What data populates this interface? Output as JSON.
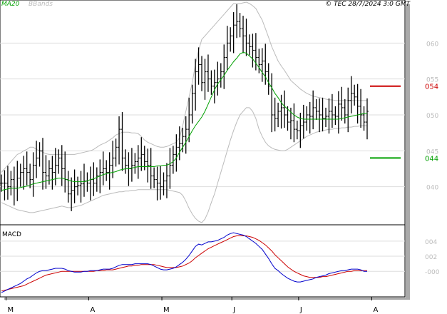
{
  "header": {
    "ma_label": "MA20",
    "bb_label": "BBands",
    "copyright": "© TEC 28/7/2024 3:0 GMT",
    "ma_color": "#00a000",
    "bb_color": "#bbbbbb"
  },
  "macd": {
    "label": "MACD",
    "macd_color": "#0000cc",
    "signal_color": "#cc0000"
  },
  "levels": {
    "resistance": {
      "label": "054",
      "value": 0.54,
      "color": "#cc0000"
    },
    "support": {
      "label": "044",
      "value": 0.44,
      "color": "#00a000"
    }
  },
  "chart_data": [
    {
      "type": "ohlc",
      "x_ticks": [
        "M",
        "A",
        "M",
        "J",
        "J",
        "A"
      ],
      "y_ticks": [
        "040",
        "045",
        "050",
        "055",
        "060"
      ],
      "y_tick_values": [
        0.4,
        0.45,
        0.5,
        0.55,
        0.6
      ],
      "ylim": [
        0.35,
        0.65
      ],
      "series": [
        {
          "kind": "close",
          "values": [
            0.405,
            0.405,
            0.4,
            0.41,
            0.398,
            0.412,
            0.42,
            0.425,
            0.42,
            0.41,
            0.43,
            0.44,
            0.45,
            0.42,
            0.415,
            0.425,
            0.42,
            0.43,
            0.44,
            0.425,
            0.41,
            0.39,
            0.395,
            0.4,
            0.402,
            0.404,
            0.408,
            0.405,
            0.41,
            0.405,
            0.415,
            0.42,
            0.425,
            0.42,
            0.43,
            0.44,
            0.455,
            0.48,
            0.44,
            0.43,
            0.425,
            0.43,
            0.435,
            0.44,
            0.445,
            0.435,
            0.43,
            0.415,
            0.41,
            0.405,
            0.4,
            0.408,
            0.415,
            0.43,
            0.445,
            0.455,
            0.46,
            0.47,
            0.48,
            0.5,
            0.53,
            0.56,
            0.57,
            0.545,
            0.56,
            0.55,
            0.54,
            0.545,
            0.55,
            0.56,
            0.58,
            0.6,
            0.61,
            0.625,
            0.63,
            0.62,
            0.61,
            0.6,
            0.595,
            0.59,
            0.58,
            0.57,
            0.575,
            0.56,
            0.54,
            0.5,
            0.495,
            0.505,
            0.51,
            0.5,
            0.49,
            0.492,
            0.48,
            0.478,
            0.485,
            0.49,
            0.5,
            0.498,
            0.51,
            0.505,
            0.5,
            0.495,
            0.498,
            0.505,
            0.5,
            0.498,
            0.515,
            0.51,
            0.5,
            0.52,
            0.53,
            0.525,
            0.512,
            0.5,
            0.49,
            0.505
          ]
        },
        {
          "kind": "ma20",
          "values": [
            0.395,
            0.396,
            0.397,
            0.398,
            0.398,
            0.398,
            0.399,
            0.4,
            0.401,
            0.402,
            0.404,
            0.405,
            0.406,
            0.407,
            0.408,
            0.409,
            0.41,
            0.411,
            0.412,
            0.412,
            0.411,
            0.409,
            0.408,
            0.407,
            0.407,
            0.407,
            0.407,
            0.408,
            0.41,
            0.411,
            0.413,
            0.415,
            0.417,
            0.418,
            0.419,
            0.42,
            0.421,
            0.423,
            0.424,
            0.425,
            0.425,
            0.426,
            0.427,
            0.428,
            0.428,
            0.428,
            0.428,
            0.428,
            0.428,
            0.429,
            0.429,
            0.43,
            0.43,
            0.432,
            0.435,
            0.44,
            0.448,
            0.455,
            0.462,
            0.47,
            0.478,
            0.485,
            0.491,
            0.497,
            0.505,
            0.515,
            0.525,
            0.535,
            0.543,
            0.549,
            0.555,
            0.562,
            0.568,
            0.574,
            0.579,
            0.585,
            0.587,
            0.586,
            0.582,
            0.578,
            0.572,
            0.566,
            0.559,
            0.553,
            0.545,
            0.538,
            0.53,
            0.524,
            0.517,
            0.512,
            0.508,
            0.504,
            0.5,
            0.497,
            0.495,
            0.494,
            0.494,
            0.494,
            0.494,
            0.494,
            0.494,
            0.494,
            0.494,
            0.494,
            0.494,
            0.494,
            0.494,
            0.495,
            0.496,
            0.497,
            0.498,
            0.499,
            0.5,
            0.501,
            0.502,
            0.502
          ]
        },
        {
          "kind": "bb_upper",
          "values": [
            0.42,
            0.425,
            0.43,
            0.435,
            0.44,
            0.445,
            0.447,
            0.45,
            0.452,
            0.455,
            0.455,
            0.452,
            0.45,
            0.448,
            0.446,
            0.445,
            0.445,
            0.445,
            0.445,
            0.445,
            0.445,
            0.445,
            0.445,
            0.445,
            0.446,
            0.447,
            0.448,
            0.449,
            0.45,
            0.452,
            0.455,
            0.458,
            0.46,
            0.462,
            0.465,
            0.468,
            0.472,
            0.474,
            0.476,
            0.476,
            0.476,
            0.475,
            0.475,
            0.474,
            0.47,
            0.465,
            0.462,
            0.46,
            0.458,
            0.456,
            0.455,
            0.455,
            0.456,
            0.458,
            0.46,
            0.462,
            0.468,
            0.485,
            0.505,
            0.525,
            0.545,
            0.57,
            0.59,
            0.605,
            0.61,
            0.615,
            0.62,
            0.625,
            0.63,
            0.635,
            0.64,
            0.645,
            0.65,
            0.655,
            0.655,
            0.655,
            0.656,
            0.657,
            0.655,
            0.652,
            0.648,
            0.64,
            0.632,
            0.62,
            0.608,
            0.595,
            0.585,
            0.575,
            0.568,
            0.562,
            0.555,
            0.548,
            0.544,
            0.54,
            0.536,
            0.533,
            0.53,
            0.528,
            0.526,
            0.525,
            0.524,
            0.523,
            0.522,
            0.521,
            0.521,
            0.52,
            0.52,
            0.52,
            0.52,
            0.52,
            0.52,
            0.52,
            0.52,
            0.52,
            0.52,
            0.52
          ]
        },
        {
          "kind": "bb_lower",
          "values": [
            0.378,
            0.376,
            0.374,
            0.372,
            0.37,
            0.368,
            0.367,
            0.366,
            0.365,
            0.364,
            0.364,
            0.365,
            0.366,
            0.367,
            0.368,
            0.369,
            0.37,
            0.371,
            0.372,
            0.373,
            0.372,
            0.371,
            0.371,
            0.372,
            0.373,
            0.374,
            0.376,
            0.378,
            0.38,
            0.382,
            0.384,
            0.386,
            0.388,
            0.389,
            0.39,
            0.391,
            0.392,
            0.393,
            0.393,
            0.394,
            0.394,
            0.395,
            0.395,
            0.396,
            0.396,
            0.396,
            0.396,
            0.396,
            0.396,
            0.396,
            0.396,
            0.396,
            0.396,
            0.395,
            0.394,
            0.393,
            0.392,
            0.388,
            0.38,
            0.37,
            0.362,
            0.356,
            0.352,
            0.35,
            0.355,
            0.365,
            0.378,
            0.39,
            0.405,
            0.42,
            0.435,
            0.45,
            0.465,
            0.478,
            0.49,
            0.5,
            0.505,
            0.51,
            0.51,
            0.505,
            0.495,
            0.48,
            0.47,
            0.462,
            0.457,
            0.454,
            0.452,
            0.451,
            0.45,
            0.45,
            0.452,
            0.455,
            0.458,
            0.461,
            0.464,
            0.467,
            0.47,
            0.472,
            0.474,
            0.476,
            0.477,
            0.478,
            0.479,
            0.48,
            0.48,
            0.481,
            0.481,
            0.482,
            0.482,
            0.483,
            0.483,
            0.484,
            0.484,
            0.485,
            0.485,
            0.485
          ]
        }
      ]
    },
    {
      "type": "line",
      "y_ticks": [
        "-000",
        "002",
        "004"
      ],
      "y_tick_values": [
        0.0,
        0.02,
        0.04
      ],
      "ylim": [
        -0.03,
        0.055
      ],
      "series": [
        {
          "kind": "macd",
          "values": [
            -0.028,
            -0.026,
            -0.024,
            -0.022,
            -0.02,
            -0.018,
            -0.016,
            -0.013,
            -0.01,
            -0.008,
            -0.005,
            -0.002,
            0.0,
            0.001,
            0.001,
            0.002,
            0.003,
            0.004,
            0.004,
            0.004,
            0.003,
            0.001,
            0.0,
            -0.001,
            -0.001,
            -0.001,
            0.0,
            0.0,
            0.001,
            0.001,
            0.001,
            0.002,
            0.003,
            0.003,
            0.003,
            0.004,
            0.006,
            0.008,
            0.009,
            0.009,
            0.009,
            0.009,
            0.01,
            0.01,
            0.01,
            0.01,
            0.01,
            0.009,
            0.007,
            0.005,
            0.003,
            0.002,
            0.002,
            0.003,
            0.004,
            0.006,
            0.009,
            0.012,
            0.016,
            0.021,
            0.027,
            0.033,
            0.036,
            0.035,
            0.037,
            0.039,
            0.039,
            0.04,
            0.041,
            0.043,
            0.045,
            0.048,
            0.05,
            0.051,
            0.05,
            0.049,
            0.048,
            0.046,
            0.043,
            0.04,
            0.037,
            0.033,
            0.029,
            0.023,
            0.017,
            0.01,
            0.004,
            0.001,
            -0.003,
            -0.006,
            -0.009,
            -0.011,
            -0.013,
            -0.014,
            -0.014,
            -0.013,
            -0.012,
            -0.011,
            -0.01,
            -0.008,
            -0.007,
            -0.006,
            -0.005,
            -0.003,
            -0.002,
            -0.001,
            0.0,
            0.001,
            0.001,
            0.002,
            0.003,
            0.003,
            0.003,
            0.002,
            0.0,
            0.0
          ]
        },
        {
          "kind": "signal",
          "values": [
            -0.026,
            -0.025,
            -0.024,
            -0.023,
            -0.022,
            -0.021,
            -0.02,
            -0.019,
            -0.017,
            -0.015,
            -0.013,
            -0.011,
            -0.009,
            -0.007,
            -0.005,
            -0.004,
            -0.003,
            -0.002,
            -0.001,
            0.0,
            0.0,
            0.0,
            0.0,
            0.0,
            0.0,
            0.0,
            0.0,
            0.0,
            0.0,
            0.0,
            0.001,
            0.001,
            0.001,
            0.002,
            0.002,
            0.002,
            0.003,
            0.004,
            0.005,
            0.006,
            0.007,
            0.007,
            0.008,
            0.008,
            0.009,
            0.009,
            0.009,
            0.009,
            0.009,
            0.008,
            0.007,
            0.006,
            0.005,
            0.005,
            0.005,
            0.005,
            0.006,
            0.007,
            0.009,
            0.011,
            0.014,
            0.018,
            0.021,
            0.024,
            0.027,
            0.03,
            0.032,
            0.034,
            0.036,
            0.038,
            0.04,
            0.042,
            0.044,
            0.046,
            0.047,
            0.047,
            0.047,
            0.047,
            0.046,
            0.045,
            0.043,
            0.041,
            0.038,
            0.035,
            0.031,
            0.027,
            0.022,
            0.018,
            0.014,
            0.01,
            0.006,
            0.003,
            0.0,
            -0.002,
            -0.004,
            -0.006,
            -0.007,
            -0.008,
            -0.008,
            -0.008,
            -0.008,
            -0.007,
            -0.007,
            -0.006,
            -0.005,
            -0.004,
            -0.003,
            -0.002,
            -0.001,
            0.0,
            0.0,
            0.001,
            0.001,
            0.001,
            0.001,
            0.001
          ]
        }
      ]
    }
  ]
}
